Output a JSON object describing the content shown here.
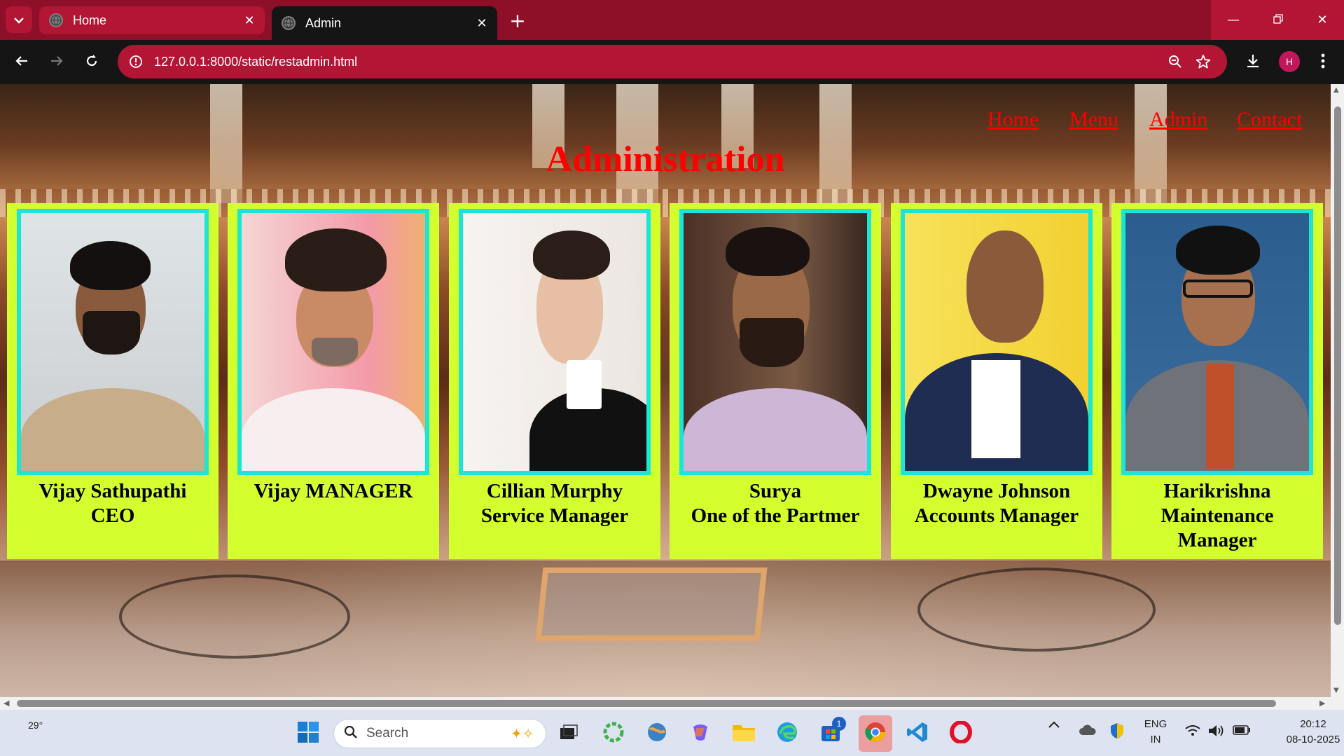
{
  "browser": {
    "tabs": [
      {
        "label": "Home",
        "active": false
      },
      {
        "label": "Admin",
        "active": true
      }
    ],
    "url": "127.0.0.1:8000/static/restadmin.html",
    "profile_initial": "H",
    "tab_color": "#b31634",
    "frame_color": "#8e0f28"
  },
  "page": {
    "nav": [
      "Home",
      "Menu",
      "Admin",
      "Contact"
    ],
    "title": "Administration",
    "title_color": "#ff0000",
    "card_color": "#d4ff2e",
    "photo_border_color": "#19e6d6",
    "staff": [
      {
        "name": "Vijay Sathupathi",
        "role": "CEO"
      },
      {
        "name": "Vijay MANAGER",
        "role": ""
      },
      {
        "name": "Cillian Murphy",
        "role": "Service Manager"
      },
      {
        "name": "Surya",
        "role": "One of the Partmer"
      },
      {
        "name": "Dwayne Johnson",
        "role": "Accounts Manager"
      },
      {
        "name": "Harikrishna",
        "role": "Maintenance Manager"
      }
    ]
  },
  "taskbar": {
    "weather": "29°",
    "search_placeholder": "Search",
    "store_badge": "1",
    "language": {
      "line1": "ENG",
      "line2": "IN"
    },
    "time": "20:12",
    "date": "08-10-2025"
  }
}
